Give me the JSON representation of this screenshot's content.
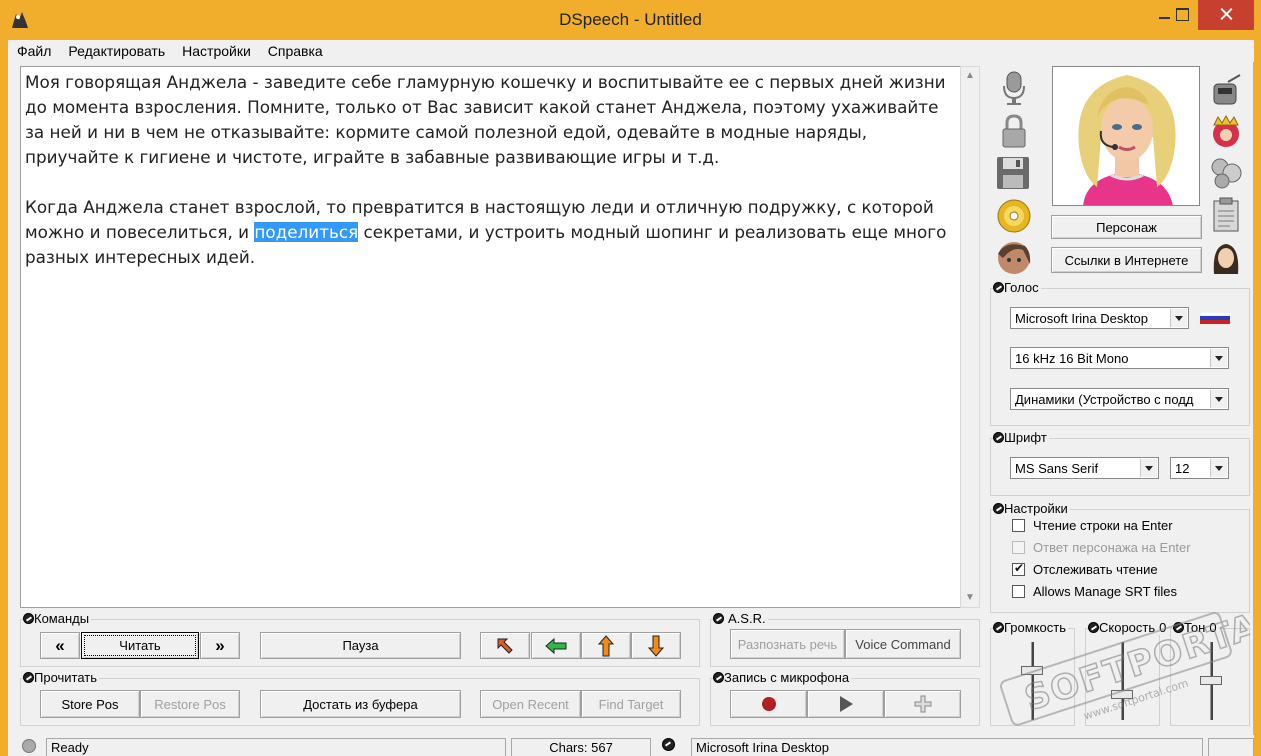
{
  "window": {
    "title": "DSpeech - Untitled"
  },
  "menu": [
    "Файл",
    "Редактировать",
    "Настройки",
    "Справка"
  ],
  "editor": {
    "para1": "Моя говорящая Анджела - заведите себе гламурную кошечку и воспитывайте ее с первых дней жизни до момента взросления. Помните, только от Вас зависит какой станет Анджела, поэтому ухаживайте за ней и ни в чем не отказывайте: кормите самой полезной едой, одевайте в модные наряды, приучайте к гигиене и чистоте, играйте в забавные развивающие игры и т.д.",
    "para2_before": "Когда Анджела станет взрослой, то превратится в настоящую леди и отличную подружку, с которой можно и повеселиться, и ",
    "para2_selected": "поделиться",
    "para2_after": " секретами, и устроить модный шопинг и реализовать еще много разных интересных идей."
  },
  "commands": {
    "label": "Команды",
    "prev": "«",
    "read": "Читать",
    "next": "»",
    "pause": "Пауза"
  },
  "read_group": {
    "label": "Прочитать",
    "store_pos": "Store Pos",
    "restore_pos": "Restore Pos",
    "from_clipboard": "Достать из буфера",
    "open_recent": "Open Recent",
    "find_target": "Find Target"
  },
  "asr": {
    "label": "A.S.R.",
    "recognize": "Разпознать речь",
    "voice_command": "Voice Command"
  },
  "mic": {
    "label": "Запись с микрофона"
  },
  "character": {
    "character_button": "Персонаж",
    "links_button": "Ссылки в Интернете"
  },
  "voice": {
    "label": "Голос",
    "engine": "Microsoft Irina Desktop",
    "format": "16 kHz 16 Bit Mono",
    "device": "Динамики (Устройство с подд"
  },
  "font": {
    "label": "Шрифт",
    "family": "MS Sans Serif",
    "size": "12"
  },
  "settings": {
    "label": "Настройки",
    "items": [
      {
        "label": "Чтение строки на Enter",
        "checked": false,
        "enabled": true
      },
      {
        "label": "Ответ персонажа на Enter",
        "checked": false,
        "enabled": false
      },
      {
        "label": "Отслеживать чтение",
        "checked": true,
        "enabled": true
      },
      {
        "label": "Allows Manage SRT files",
        "checked": false,
        "enabled": true
      }
    ]
  },
  "sliders": {
    "volume_label": "Громкость",
    "speed_label": "Скорость",
    "speed_value": "0",
    "pitch_label": "Тон",
    "pitch_value": "0"
  },
  "status": {
    "state": "Ready",
    "chars": "Chars: 567",
    "voice": "Microsoft Irina Desktop"
  },
  "colors": {
    "frame": "#f0ae2c",
    "close": "#c7402f",
    "selection": "#3399ff",
    "record": "#b02020"
  },
  "watermark": "SOFTPORTAL www.softportal.com"
}
